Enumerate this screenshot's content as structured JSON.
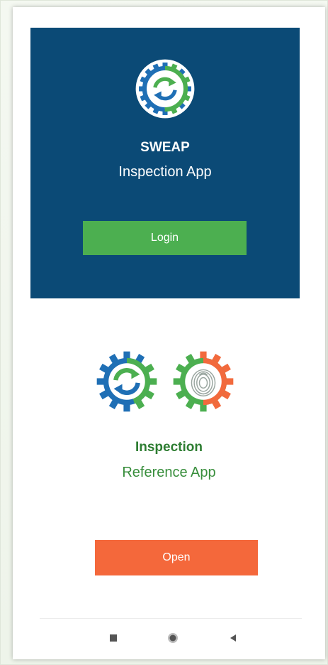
{
  "sweap": {
    "title": "SWEAP",
    "subtitle": "Inspection App",
    "login_label": "Login",
    "logo_icon": "sweap-gear-sync-icon"
  },
  "reference": {
    "title": "Inspection",
    "subtitle": "Reference App",
    "open_label": "Open",
    "logo_icons": [
      "sweap-gear-sync-icon",
      "fingerprint-gear-icon"
    ]
  },
  "navbar": {
    "icons": [
      "square-icon",
      "home-circle-icon",
      "back-triangle-icon"
    ]
  },
  "colors": {
    "banner_bg": "#0b4a76",
    "login_button": "#4caf50",
    "open_button": "#f4683b",
    "gear_blue": "#1f6fb5",
    "gear_green": "#4caf50",
    "gear_orange": "#f26a3d",
    "text_green": "#2e7d32"
  }
}
